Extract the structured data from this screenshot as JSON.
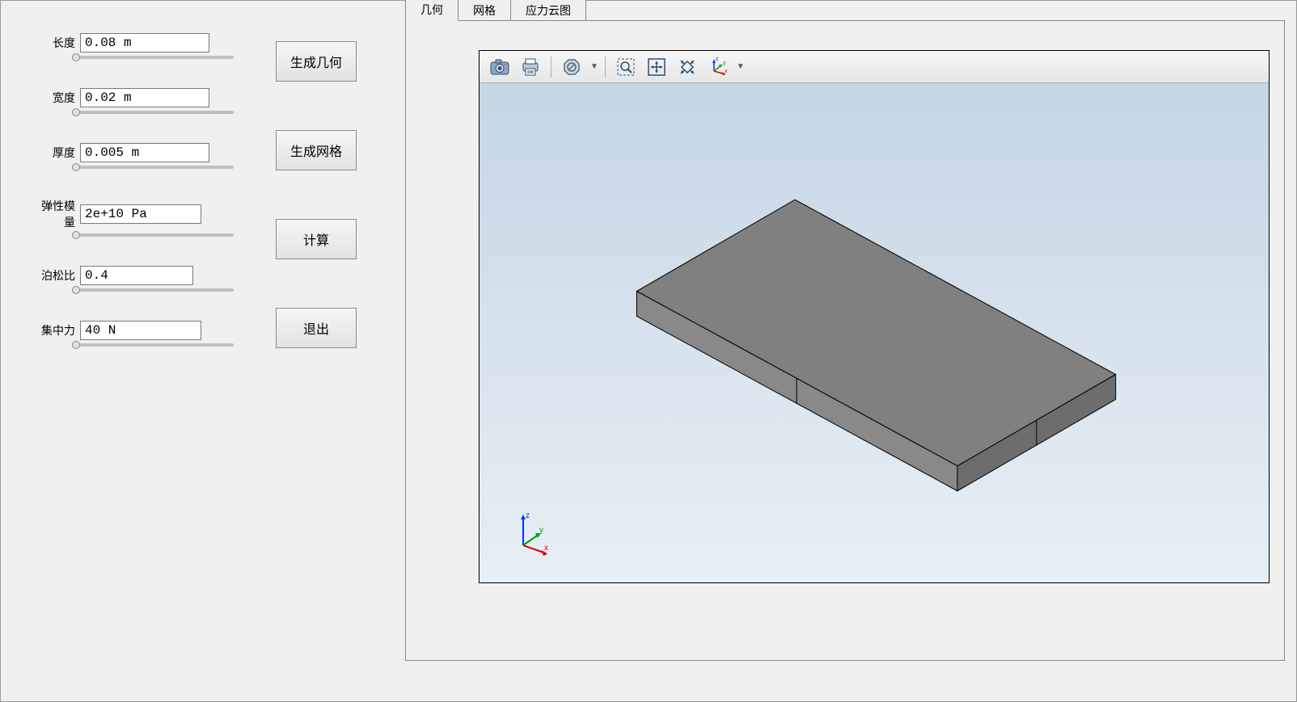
{
  "params": {
    "length": {
      "label": "长度",
      "value": "0.08 m"
    },
    "width": {
      "label": "宽度",
      "value": "0.02 m"
    },
    "thick": {
      "label": "厚度",
      "value": "0.005 m"
    },
    "emod": {
      "label": "弹性模量",
      "value": "2e+10 Pa"
    },
    "poisson": {
      "label": "泊松比",
      "value": "0.4"
    },
    "force": {
      "label": "集中力",
      "value": "40 N"
    }
  },
  "buttons": {
    "gen_geom": "生成几何",
    "gen_mesh": "生成网格",
    "compute": "计算",
    "exit": "退出"
  },
  "tabs": {
    "geometry": "几何",
    "mesh": "网格",
    "contour": "应力云图"
  },
  "toolbar_icons": {
    "snapshot": "camera-icon",
    "print": "print-icon",
    "nosign": "no-symbol-icon",
    "zoombox": "zoom-box-icon",
    "fit": "fit-view-icon",
    "zoomext": "zoom-extents-icon",
    "axes": "axes-orient-icon"
  },
  "triad": {
    "x": "x",
    "y": "y",
    "z": "z"
  },
  "colors": {
    "slab_top": "#808080",
    "slab_side": "#6d6d6d",
    "slab_front": "#898989",
    "edge": "#000000"
  }
}
